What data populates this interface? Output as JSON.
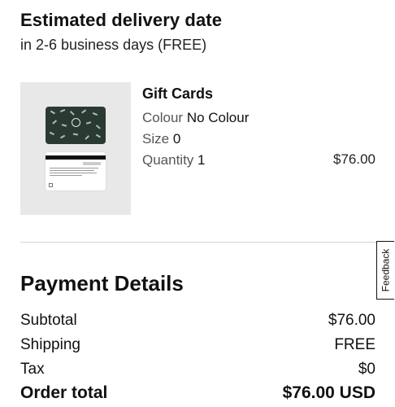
{
  "delivery": {
    "title": "Estimated delivery date",
    "subtitle": "in 2-6 business days (FREE)"
  },
  "product": {
    "name": "Gift Cards",
    "colour_label": "Colour",
    "colour_value": "No Colour",
    "size_label": "Size",
    "size_value": "0",
    "quantity_label": "Quantity",
    "quantity_value": "1",
    "price": "$76.00"
  },
  "feedback": {
    "label": "Feedback"
  },
  "payment": {
    "title": "Payment Details",
    "rows": [
      {
        "label": "Subtotal",
        "value": "$76.00"
      },
      {
        "label": "Shipping",
        "value": "FREE"
      },
      {
        "label": "Tax",
        "value": "$0"
      },
      {
        "label": "Order total",
        "value": "$76.00 USD"
      }
    ]
  },
  "colors": {
    "card_green": "#2a3a33",
    "image_bg": "#e8e8e8",
    "divider": "#d4d4d4"
  }
}
